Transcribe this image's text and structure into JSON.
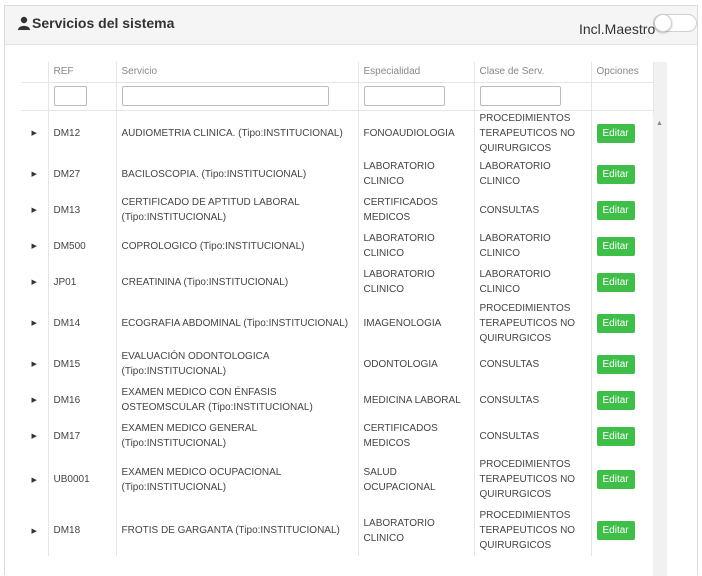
{
  "panel": {
    "title": "Servicios del sistema",
    "toggle_label": "Incl.Maestro",
    "toggle_on": false
  },
  "table": {
    "headers": [
      "REF",
      "Servicio",
      "Especialidad",
      "Clase de Serv.",
      "Opciones"
    ],
    "edit_label": "Editar",
    "rows": [
      {
        "ref": "DM12",
        "servicio": "AUDIOMETRIA CLINICA. (Tipo:INSTITUCIONAL)",
        "especialidad": "FONOAUDIOLOGIA",
        "clase": "PROCEDIMIENTOS TERAPEUTICOS NO QUIRURGICOS"
      },
      {
        "ref": "DM27",
        "servicio": "BACILOSCOPIA. (Tipo:INSTITUCIONAL)",
        "especialidad": "LABORATORIO CLINICO",
        "clase": "LABORATORIO CLINICO"
      },
      {
        "ref": "DM13",
        "servicio": "CERTIFICADO DE APTITUD LABORAL (Tipo:INSTITUCIONAL)",
        "especialidad": "CERTIFICADOS MEDICOS",
        "clase": "CONSULTAS"
      },
      {
        "ref": "DM500",
        "servicio": "COPROLOGICO (Tipo:INSTITUCIONAL)",
        "especialidad": "LABORATORIO CLINICO",
        "clase": "LABORATORIO CLINICO"
      },
      {
        "ref": "JP01",
        "servicio": "CREATININA (Tipo:INSTITUCIONAL)",
        "especialidad": "LABORATORIO CLINICO",
        "clase": "LABORATORIO CLINICO"
      },
      {
        "ref": "DM14",
        "servicio": "ECOGRAFIA ABDOMINAL (Tipo:INSTITUCIONAL)",
        "especialidad": "IMAGENOLOGIA",
        "clase": "PROCEDIMIENTOS TERAPEUTICOS NO QUIRURGICOS"
      },
      {
        "ref": "DM15",
        "servicio": "EVALUACIÓN ODONTOLOGICA (Tipo:INSTITUCIONAL)",
        "especialidad": "ODONTOLOGIA",
        "clase": "CONSULTAS"
      },
      {
        "ref": "DM16",
        "servicio": "EXAMEN MEDICO CON ÉNFASIS OSTEOMSCULAR (Tipo:INSTITUCIONAL)",
        "especialidad": "MEDICINA LABORAL",
        "clase": "CONSULTAS"
      },
      {
        "ref": "DM17",
        "servicio": "EXAMEN MEDICO GENERAL (Tipo:INSTITUCIONAL)",
        "especialidad": "CERTIFICADOS MEDICOS",
        "clase": "CONSULTAS"
      },
      {
        "ref": "UB0001",
        "servicio": "EXAMEN MEDICO OCUPACIONAL (Tipo:INSTITUCIONAL)",
        "especialidad": "SALUD OCUPACIONAL",
        "clase": "PROCEDIMIENTOS TERAPEUTICOS NO QUIRURGICOS"
      },
      {
        "ref": "DM18",
        "servicio": "FROTIS DE GARGANTA (Tipo:INSTITUCIONAL)",
        "especialidad": "LABORATORIO CLINICO",
        "clase": "PROCEDIMIENTOS TERAPEUTICOS NO QUIRURGICOS"
      }
    ]
  },
  "colors": {
    "edit_button": "#3fbf4a",
    "header_bg": "#f5f5f5"
  }
}
